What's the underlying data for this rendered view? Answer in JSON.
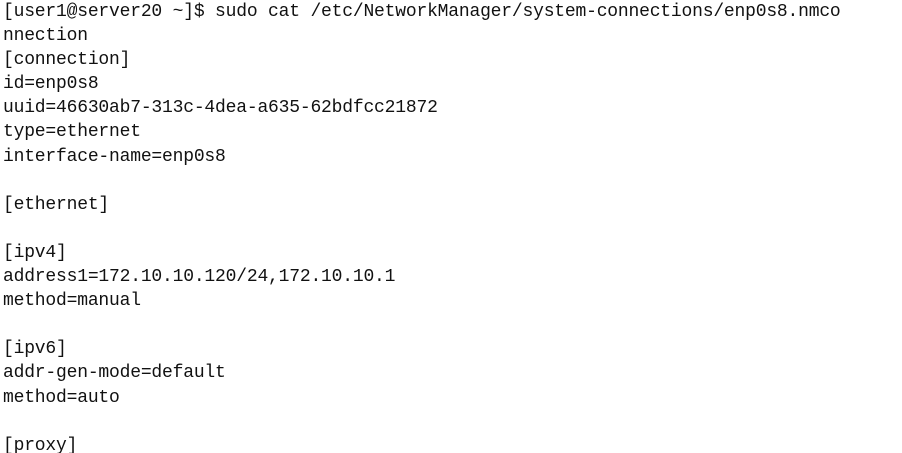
{
  "terminal": {
    "lines": [
      "[user1@server20 ~]$ sudo cat /etc/NetworkManager/system-connections/enp0s8.nmco",
      "nnection",
      "[connection]",
      "id=enp0s8",
      "uuid=46630ab7-313c-4dea-a635-62bdfcc21872",
      "type=ethernet",
      "interface-name=enp0s8",
      "",
      "[ethernet]",
      "",
      "[ipv4]",
      "address1=172.10.10.120/24,172.10.10.1",
      "method=manual",
      "",
      "[ipv6]",
      "addr-gen-mode=default",
      "method=auto",
      "",
      "[proxy]"
    ],
    "colors": {
      "background": "#ffffff",
      "text": "#111111"
    }
  }
}
